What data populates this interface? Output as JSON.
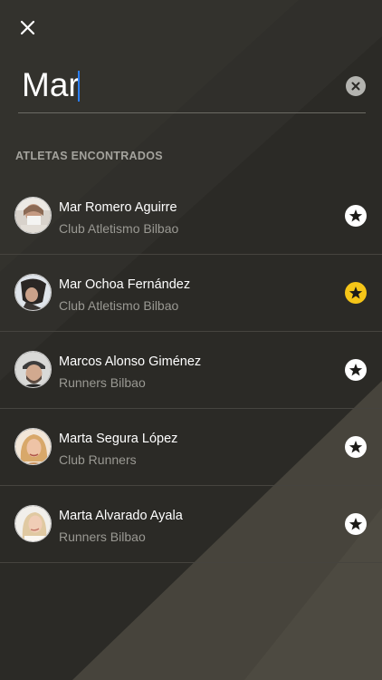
{
  "search": {
    "value": "Mar"
  },
  "section": {
    "title": "ATLETAS ENCONTRADOS"
  },
  "athletes": [
    {
      "name": "Mar Romero Aguirre",
      "club": "Club Atletismo Bilbao",
      "favorite": false
    },
    {
      "name": "Mar Ochoa Fernández",
      "club": "Club Atletismo Bilbao",
      "favorite": true
    },
    {
      "name": "Marcos Alonso Giménez",
      "club": "Runners Bilbao",
      "favorite": false
    },
    {
      "name": "Marta Segura López",
      "club": "Club Runners",
      "favorite": false
    },
    {
      "name": "Marta Alvarado Ayala",
      "club": "Runners Bilbao",
      "favorite": false
    }
  ],
  "colors": {
    "background": "#2b2a26",
    "favorite_active": "#f5c518",
    "cursor": "#2a7fff"
  },
  "icons": {
    "close": "close-icon",
    "clear": "clear-search-icon",
    "favorite": "star-icon"
  }
}
